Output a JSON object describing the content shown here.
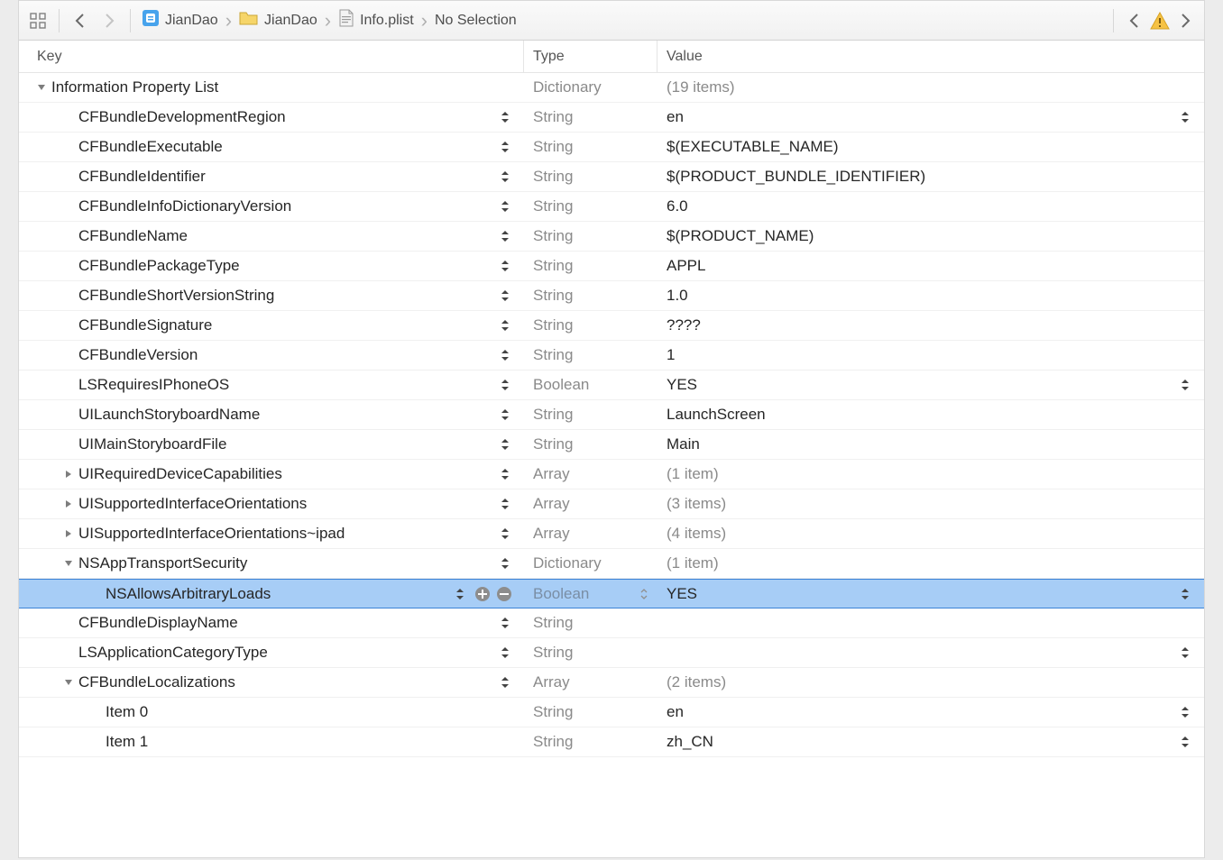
{
  "toolbar": {
    "back_enabled": true,
    "fwd_enabled": false
  },
  "breadcrumb": [
    {
      "icon": "app",
      "label": "JianDao"
    },
    {
      "icon": "folder",
      "label": "JianDao"
    },
    {
      "icon": "plist",
      "label": "Info.plist"
    },
    {
      "icon": "",
      "label": "No Selection"
    }
  ],
  "header": {
    "key": "Key",
    "type": "Type",
    "value": "Value"
  },
  "rows": [
    {
      "indent": 0,
      "tri": "down",
      "key": "Information Property List",
      "type": "Dictionary",
      "value": "(19 items)",
      "dim": true,
      "key_step": false,
      "val_step": false,
      "type_step": false
    },
    {
      "indent": 1,
      "tri": "none",
      "key": "CFBundleDevelopmentRegion",
      "type": "String",
      "value": "en",
      "dim": false,
      "key_step": true,
      "val_step": true
    },
    {
      "indent": 1,
      "tri": "none",
      "key": "CFBundleExecutable",
      "type": "String",
      "value": "$(EXECUTABLE_NAME)",
      "dim": false,
      "key_step": true,
      "val_step": false
    },
    {
      "indent": 1,
      "tri": "none",
      "key": "CFBundleIdentifier",
      "type": "String",
      "value": "$(PRODUCT_BUNDLE_IDENTIFIER)",
      "dim": false,
      "key_step": true,
      "val_step": false
    },
    {
      "indent": 1,
      "tri": "none",
      "key": "CFBundleInfoDictionaryVersion",
      "type": "String",
      "value": "6.0",
      "dim": false,
      "key_step": true,
      "val_step": false
    },
    {
      "indent": 1,
      "tri": "none",
      "key": "CFBundleName",
      "type": "String",
      "value": "$(PRODUCT_NAME)",
      "dim": false,
      "key_step": true,
      "val_step": false
    },
    {
      "indent": 1,
      "tri": "none",
      "key": "CFBundlePackageType",
      "type": "String",
      "value": "APPL",
      "dim": false,
      "key_step": true,
      "val_step": false
    },
    {
      "indent": 1,
      "tri": "none",
      "key": "CFBundleShortVersionString",
      "type": "String",
      "value": "1.0",
      "dim": false,
      "key_step": true,
      "val_step": false
    },
    {
      "indent": 1,
      "tri": "none",
      "key": "CFBundleSignature",
      "type": "String",
      "value": "????",
      "dim": false,
      "key_step": true,
      "val_step": false
    },
    {
      "indent": 1,
      "tri": "none",
      "key": "CFBundleVersion",
      "type": "String",
      "value": "1",
      "dim": false,
      "key_step": true,
      "val_step": false
    },
    {
      "indent": 1,
      "tri": "none",
      "key": "LSRequiresIPhoneOS",
      "type": "Boolean",
      "value": "YES",
      "dim": false,
      "key_step": true,
      "val_step": true
    },
    {
      "indent": 1,
      "tri": "none",
      "key": "UILaunchStoryboardName",
      "type": "String",
      "value": "LaunchScreen",
      "dim": false,
      "key_step": true,
      "val_step": false
    },
    {
      "indent": 1,
      "tri": "none",
      "key": "UIMainStoryboardFile",
      "type": "String",
      "value": "Main",
      "dim": false,
      "key_step": true,
      "val_step": false
    },
    {
      "indent": 1,
      "tri": "right",
      "key": "UIRequiredDeviceCapabilities",
      "type": "Array",
      "value": "(1 item)",
      "dim": true,
      "key_step": true,
      "val_step": false
    },
    {
      "indent": 1,
      "tri": "right",
      "key": "UISupportedInterfaceOrientations",
      "type": "Array",
      "value": "(3 items)",
      "dim": true,
      "key_step": true,
      "val_step": false
    },
    {
      "indent": 1,
      "tri": "right",
      "key": "UISupportedInterfaceOrientations~ipad",
      "type": "Array",
      "value": "(4 items)",
      "dim": true,
      "key_step": true,
      "val_step": false
    },
    {
      "indent": 1,
      "tri": "down",
      "key": "NSAppTransportSecurity",
      "type": "Dictionary",
      "value": "(1 item)",
      "dim": true,
      "key_step": true,
      "val_step": false
    },
    {
      "indent": 2,
      "tri": "none",
      "key": "NSAllowsArbitraryLoads",
      "type": "Boolean",
      "value": "YES",
      "dim": false,
      "key_step": true,
      "val_step": true,
      "selected": true,
      "plusminus": true,
      "type_step": true
    },
    {
      "indent": 1,
      "tri": "none",
      "key": "CFBundleDisplayName",
      "type": "String",
      "value": "",
      "dim": false,
      "key_step": true,
      "val_step": false
    },
    {
      "indent": 1,
      "tri": "none",
      "key": "LSApplicationCategoryType",
      "type": "String",
      "value": "",
      "dim": false,
      "key_step": true,
      "val_step": true
    },
    {
      "indent": 1,
      "tri": "down",
      "key": "CFBundleLocalizations",
      "type": "Array",
      "value": "(2 items)",
      "dim": true,
      "key_step": true,
      "val_step": false
    },
    {
      "indent": 2,
      "tri": "none",
      "key": "Item 0",
      "type": "String",
      "value": "en",
      "dim": false,
      "key_step": false,
      "val_step": true
    },
    {
      "indent": 2,
      "tri": "none",
      "key": "Item 1",
      "type": "String",
      "value": "zh_CN",
      "dim": false,
      "key_step": false,
      "val_step": true
    }
  ]
}
